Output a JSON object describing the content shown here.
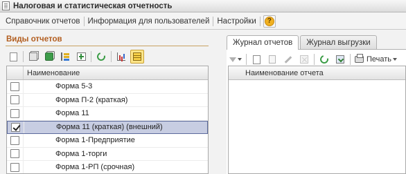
{
  "window": {
    "title": "Налоговая и статистическая отчетность"
  },
  "menu": {
    "items": [
      {
        "label": "Справочник отчетов"
      },
      {
        "label": "Информация для пользователей"
      },
      {
        "label": "Настройки"
      }
    ],
    "help_glyph": "?"
  },
  "left_panel": {
    "title": "Виды отчетов",
    "toolbar_icons": [
      "new-document-icon",
      "copy-icon",
      "copy-green-icon",
      "tree-icon",
      "add-folder-icon",
      "refresh-icon",
      "chart-icon",
      "grid-view-icon"
    ],
    "table": {
      "column_name": "Наименование",
      "rows": [
        {
          "name": "Форма 5-3",
          "checked": false,
          "selected": false
        },
        {
          "name": "Форма П-2 (краткая)",
          "checked": false,
          "selected": false
        },
        {
          "name": "Форма 11",
          "checked": false,
          "selected": false
        },
        {
          "name": "Форма 11 (краткая) (внешний)",
          "checked": true,
          "selected": true
        },
        {
          "name": "Форма 1-Предприятие",
          "checked": false,
          "selected": false
        },
        {
          "name": "Форма 1-торги",
          "checked": false,
          "selected": false
        },
        {
          "name": "Форма 1-РП (срочная)",
          "checked": false,
          "selected": false
        }
      ]
    }
  },
  "right_panel": {
    "tabs": [
      {
        "label": "Журнал отчетов",
        "active": true
      },
      {
        "label": "Журнал выгрузки",
        "active": false
      }
    ],
    "print_label": "Печать",
    "table": {
      "column_name": "Наименование отчета"
    }
  },
  "colors": {
    "accent_title": "#b25d1e",
    "selection_bg": "#c7cde2",
    "selection_border": "#5b6a9b",
    "active_button": "#fde58a"
  }
}
